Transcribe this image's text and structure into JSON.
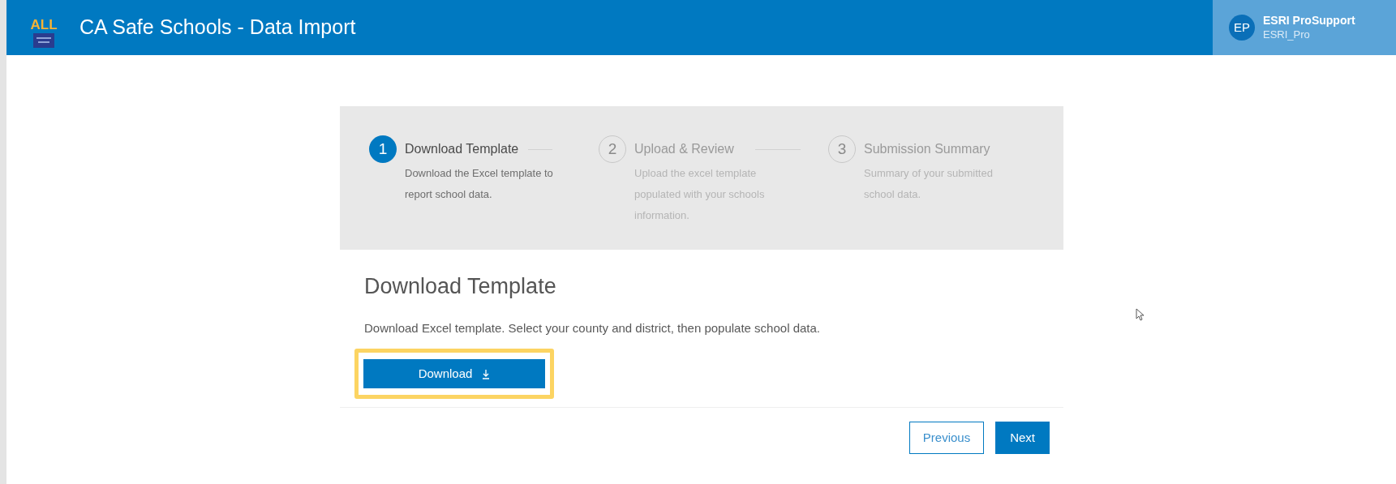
{
  "header": {
    "logo_text": "ALL",
    "title": "CA Safe Schools - Data Import",
    "user": {
      "initials": "EP",
      "name": "ESRI ProSupport",
      "username": "ESRI_Pro"
    }
  },
  "steps": [
    {
      "number": "1",
      "title": "Download Template",
      "description": "Download the Excel template to report school data.",
      "selected": true
    },
    {
      "number": "2",
      "title": "Upload & Review",
      "description": "Upload the excel template populated with your schools information.",
      "selected": false
    },
    {
      "number": "3",
      "title": "Submission Summary",
      "description": "Summary of your submitted school data.",
      "selected": false
    }
  ],
  "section": {
    "heading": "Download Template",
    "text": "Download Excel template. Select your county and district, then populate school data.",
    "download_button": {
      "label": "Download",
      "highlighted": true
    }
  },
  "buttons": [
    {
      "label": "Previous",
      "kind": "outline"
    },
    {
      "label": "Next",
      "kind": "primary"
    }
  ]
}
